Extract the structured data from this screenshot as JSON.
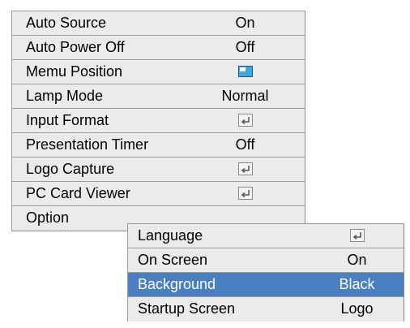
{
  "main_menu": {
    "items": [
      {
        "label": "Auto Source",
        "value": "On",
        "icon": null
      },
      {
        "label": "Auto Power Off",
        "value": "Off",
        "icon": null
      },
      {
        "label": "Memu Position",
        "value": null,
        "icon": "menu-position-icon"
      },
      {
        "label": "Lamp Mode",
        "value": "Normal",
        "icon": null
      },
      {
        "label": "Input Format",
        "value": null,
        "icon": "enter-icon"
      },
      {
        "label": "Presentation Timer",
        "value": "Off",
        "icon": null
      },
      {
        "label": "Logo Capture",
        "value": null,
        "icon": "enter-icon"
      },
      {
        "label": "PC Card Viewer",
        "value": null,
        "icon": "enter-icon"
      },
      {
        "label": "Option",
        "value": null,
        "icon": null
      }
    ]
  },
  "submenu": {
    "items": [
      {
        "label": "Language",
        "value": null,
        "icon": "enter-icon"
      },
      {
        "label": "On Screen",
        "value": "On",
        "icon": null
      },
      {
        "label": "Background",
        "value": "Black",
        "icon": null,
        "selected": true
      },
      {
        "label": "Startup Screen",
        "value": "Logo",
        "icon": null
      }
    ]
  },
  "colors": {
    "menu_background": "#ebebeb",
    "selected_background": "#4a7fc2",
    "selected_text": "#ffffff",
    "border": "#9a9a9a"
  }
}
